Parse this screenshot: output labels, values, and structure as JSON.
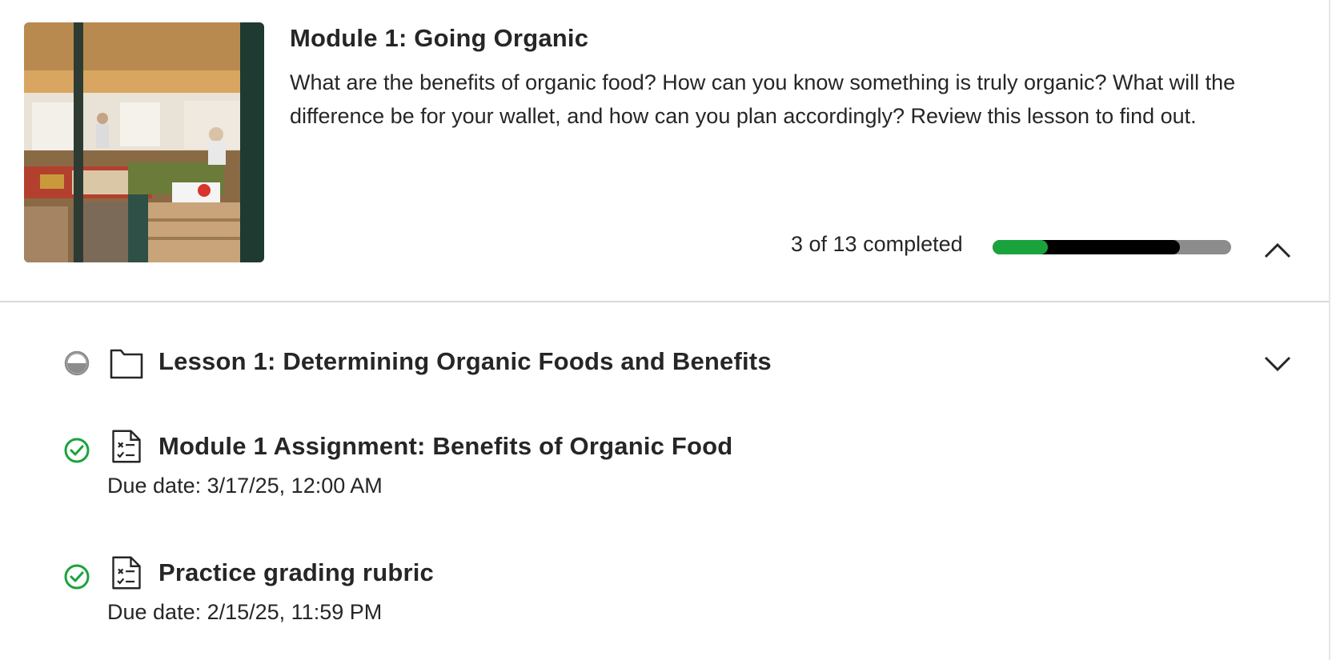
{
  "module": {
    "title": "Module 1: Going Organic",
    "description": "What are the benefits of organic food? How can you know something is truly organic? What will the difference be for your wallet, and how can you plan accordingly? Review this lesson to find out.",
    "thumbnail_icon": "market-photo",
    "progress": {
      "text": "3 of 13 completed",
      "completed_fraction": 0.23,
      "in_progress_fraction": 0.77,
      "colors": {
        "completed": "#1aa33c",
        "in_progress": "#000000",
        "remaining": "#8c8c8c"
      }
    },
    "collapse_icon": "chevron-up-icon"
  },
  "items": [
    {
      "status": "in-progress",
      "status_icon": "half-circle-icon",
      "type_icon": "folder-icon",
      "title": "Lesson 1: Determining Organic Foods and Benefits",
      "expand_icon": "chevron-down-icon"
    },
    {
      "status": "completed",
      "status_icon": "check-circle-icon",
      "type_icon": "assignment-icon",
      "title": "Module 1 Assignment: Benefits of Organic Food",
      "due": "Due date: 3/17/25, 12:00 AM"
    },
    {
      "status": "completed",
      "status_icon": "check-circle-icon",
      "type_icon": "assignment-icon",
      "title": "Practice grading rubric",
      "due": "Due date: 2/15/25, 11:59 PM"
    }
  ]
}
